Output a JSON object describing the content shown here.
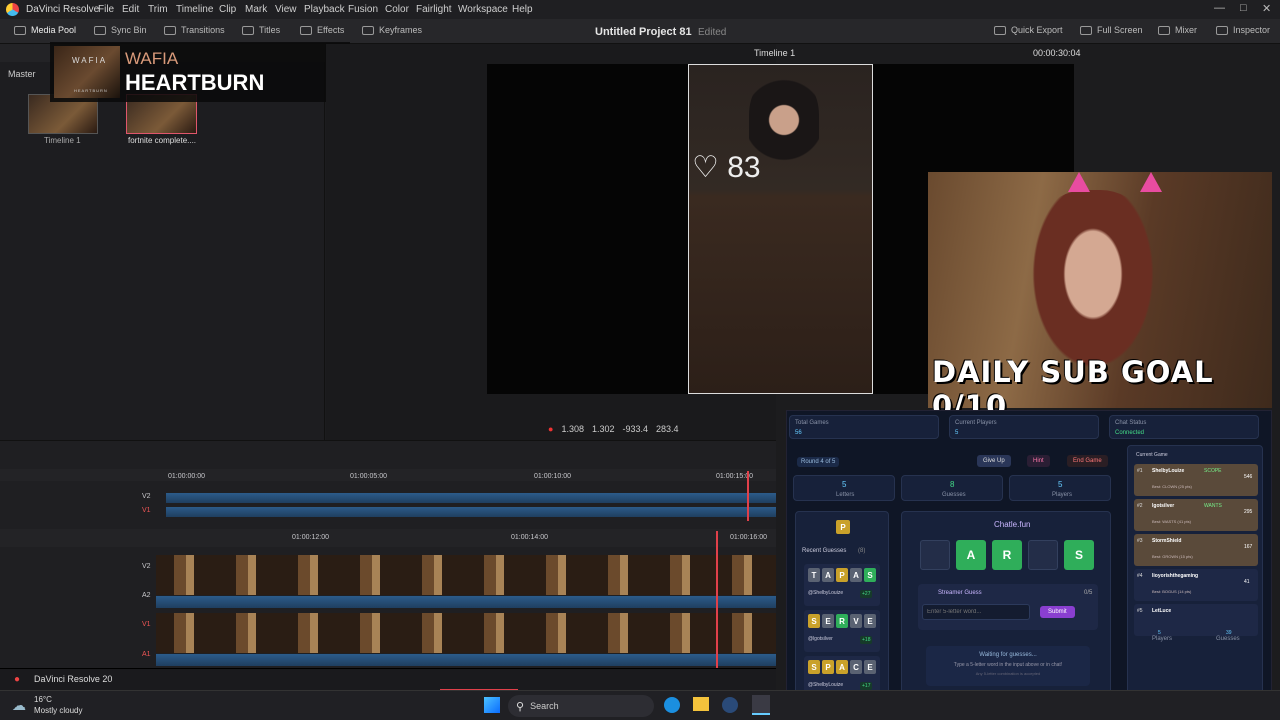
{
  "menubar": {
    "app": "DaVinci Resolve",
    "items": [
      "File",
      "Edit",
      "Trim",
      "Timeline",
      "Clip",
      "Mark",
      "View",
      "Playback",
      "Fusion",
      "Color",
      "Fairlight",
      "Workspace",
      "Help"
    ]
  },
  "toolbar": {
    "media_pool": "Media Pool",
    "sync_bin": "Sync Bin",
    "transitions": "Transitions",
    "titles": "Titles",
    "effects": "Effects",
    "keyframes": "Keyframes",
    "quick_export": "Quick Export",
    "full_screen": "Full Screen",
    "mixer": "Mixer",
    "inspector": "Inspector"
  },
  "project": {
    "title": "Untitled Project 81",
    "status": "Edited"
  },
  "viewer": {
    "timeline_name": "Timeline 1",
    "timecode": "00:00:30:04",
    "zoom_x": "1.308",
    "zoom_y": "1.302",
    "pos_x": "-933.4",
    "pos_y": "283.4"
  },
  "media_pool": {
    "bin": "Master",
    "items": [
      {
        "label": "Timeline 1"
      },
      {
        "label": "fortnite complete...."
      }
    ]
  },
  "now_playing": {
    "artist": "WAFIA",
    "song": "HEARTBURN",
    "thumb_artist": "WAFIA",
    "thumb_song": "HEARTBURN"
  },
  "overlay": {
    "heart_count": "83",
    "sub_goal": "DAILY SUB GOAL 0/10"
  },
  "timeline": {
    "ruler_top": [
      "01:00:00:00",
      "01:00:05:00",
      "01:00:10:00",
      "01:00:15:00"
    ],
    "ruler_bottom": [
      "01:00:12:00",
      "01:00:14:00",
      "01:00:16:00"
    ],
    "tracks_top": [
      "V2",
      "V1"
    ],
    "tracks_bottom": [
      "V2",
      "A2",
      "V1",
      "A1"
    ]
  },
  "pagebar": {
    "version": "DaVinci Resolve 20"
  },
  "taskbar": {
    "temp": "16°C",
    "weather": "Mostly cloudy",
    "search": "Search"
  },
  "game": {
    "stats": [
      {
        "label": "Total Games",
        "value": "56"
      },
      {
        "label": "Current Players",
        "value": "5"
      },
      {
        "label": "Chat Status",
        "value": "Connected"
      }
    ],
    "round": "Round 4 of 5",
    "give_up": "Give Up",
    "hint": "Hint",
    "end_game": "End Game",
    "info": [
      {
        "value": "5",
        "label": "Letters"
      },
      {
        "value": "8",
        "label": "Guesses"
      },
      {
        "value": "5",
        "label": "Players"
      }
    ],
    "hint_letter": "P",
    "recent_title": "Recent Guesses",
    "recent_count": "(8)",
    "recent": [
      {
        "letters": [
          "T",
          "A",
          "P",
          "A",
          "S"
        ],
        "colors": [
          "gr",
          "gr",
          "y",
          "gr",
          "g"
        ],
        "user": "@ShelbyLouize",
        "pts": "+27"
      },
      {
        "letters": [
          "S",
          "E",
          "R",
          "V",
          "E"
        ],
        "colors": [
          "y",
          "gr",
          "g",
          "gr",
          "gr"
        ],
        "user": "@lgotsilver",
        "pts": "+18"
      },
      {
        "letters": [
          "S",
          "P",
          "A",
          "C",
          "E"
        ],
        "colors": [
          "y",
          "y",
          "y",
          "gr",
          "gr"
        ],
        "user": "@ShelbyLouize",
        "pts": "+17"
      }
    ],
    "brand": "Chatle.fun",
    "board": [
      "",
      "A",
      "R",
      "",
      "S"
    ],
    "board_colors": [
      "e",
      "g",
      "g",
      "e",
      "g"
    ],
    "streamer_guess": "Streamer Guess",
    "streamer_count": "0/5",
    "input_placeholder": "Enter 5-letter word...",
    "submit": "Submit",
    "waiting": "Waiting for guesses...",
    "waiting_sub": "Type a 5-letter word in the input above or in chat!",
    "waiting_sub2": "Any 5-letter combination is accepted",
    "current_title": "Current Game",
    "players": [
      {
        "rank": "#1",
        "name": "ShelbyLouize",
        "tag": "SCOPE",
        "pts": "546",
        "best": "Best: CLOWN (25 pts)"
      },
      {
        "rank": "#2",
        "name": "lgotsilver",
        "tag": "WANTS",
        "pts": "295",
        "best": "Best: WASTS (41 pts)"
      },
      {
        "rank": "#3",
        "name": "StormShield",
        "tag": "",
        "pts": "167",
        "best": "Best: GROWN (15 pts)"
      },
      {
        "rank": "#4",
        "name": "lioyorishthegaming",
        "tag": "",
        "pts": "41",
        "best": "Best: BOGUS (14 pts)"
      },
      {
        "rank": "#5",
        "name": "LetLuce",
        "tag": "",
        "pts": "",
        "best": ""
      }
    ],
    "footer": [
      {
        "value": "5",
        "label": "Players"
      },
      {
        "value": "39",
        "label": "Guesses"
      }
    ]
  }
}
